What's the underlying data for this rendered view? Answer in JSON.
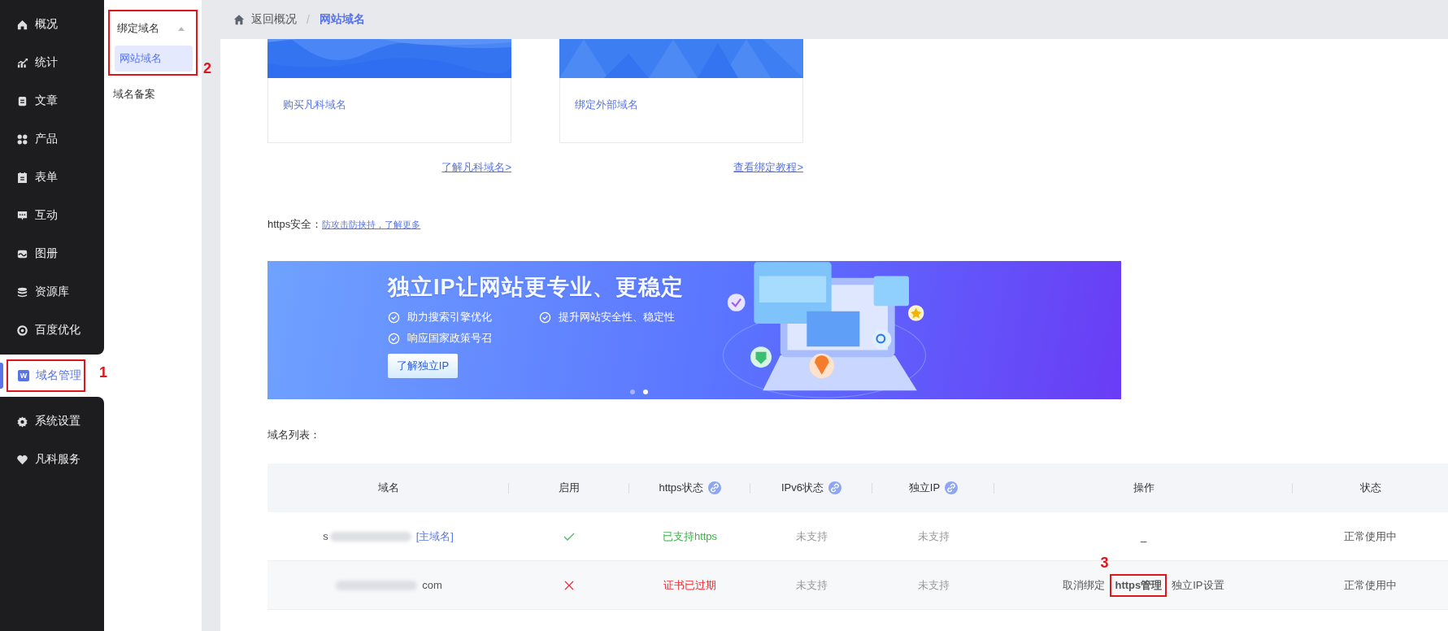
{
  "nav": {
    "items": [
      {
        "label": "概况",
        "selected": false
      },
      {
        "label": "统计",
        "selected": false
      },
      {
        "label": "文章",
        "selected": false
      },
      {
        "label": "产品",
        "selected": false
      },
      {
        "label": "表单",
        "selected": false
      },
      {
        "label": "互动",
        "selected": false
      },
      {
        "label": "图册",
        "selected": false
      },
      {
        "label": "资源库",
        "selected": false
      },
      {
        "label": "百度优化",
        "selected": false
      },
      {
        "label": "域名管理",
        "selected": true,
        "badge": "W",
        "annotation": "1"
      },
      {
        "label": "系统设置",
        "selected": false
      },
      {
        "label": "凡科服务",
        "selected": false
      }
    ]
  },
  "subnav": {
    "groups": [
      {
        "label": "绑定域名",
        "expanded": true,
        "annotation": "2",
        "children": [
          {
            "label": "网站域名",
            "selected": true
          }
        ]
      },
      {
        "label": "域名备案",
        "expanded": false
      }
    ]
  },
  "breadcrumb": {
    "back": "返回概况",
    "separator": "/",
    "current": "网站域名"
  },
  "cards": [
    {
      "title": "购买凡科域名",
      "link": "了解凡科域名>",
      "kind": "waves"
    },
    {
      "title": "绑定外部域名",
      "link": "查看绑定教程>",
      "kind": "peaks"
    }
  ],
  "https_security": {
    "label": "https安全：",
    "link": "防攻击防挟持，了解更多"
  },
  "banner": {
    "title": "独立IP让网站更专业、更稳定",
    "features": [
      "助力搜索引擎优化",
      "提升网站安全性、稳定性",
      "响应国家政策号召"
    ],
    "button": "了解独立IP",
    "dots": [
      {
        "selected": false
      },
      {
        "selected": true
      }
    ]
  },
  "list_label": "域名列表：",
  "table": {
    "columns": [
      {
        "label": "域名",
        "info": false
      },
      {
        "label": "启用",
        "info": false
      },
      {
        "label": "https状态",
        "info": true
      },
      {
        "label": "IPv6状态",
        "info": true
      },
      {
        "label": "独立IP",
        "info": true
      },
      {
        "label": "操作",
        "info": false
      },
      {
        "label": "状态",
        "info": false
      }
    ],
    "rows": [
      {
        "domain": [
          {
            "kind": "text",
            "text": "s"
          },
          {
            "kind": "redacted"
          },
          {
            "kind": "tag",
            "text": "[主域名]"
          }
        ],
        "enabled": true,
        "https": {
          "text": "已支持https",
          "kind": "ok"
        },
        "ipv6": "未支持",
        "independent_ip": "未支持",
        "actions": [
          {
            "kind": "none",
            "text": "_"
          }
        ],
        "status": "正常使用中"
      },
      {
        "domain": [
          {
            "kind": "redacted"
          },
          {
            "kind": "text",
            "text": "com"
          }
        ],
        "enabled": false,
        "https": {
          "text": "证书已过期",
          "kind": "error"
        },
        "ipv6": "未支持",
        "independent_ip": "未支持",
        "actions": [
          {
            "kind": "link",
            "text": "取消绑定"
          },
          {
            "kind": "link",
            "text": "https管理",
            "annotation": "3"
          },
          {
            "kind": "link",
            "text": "独立IP设置"
          }
        ],
        "status": "正常使用中"
      }
    ]
  }
}
